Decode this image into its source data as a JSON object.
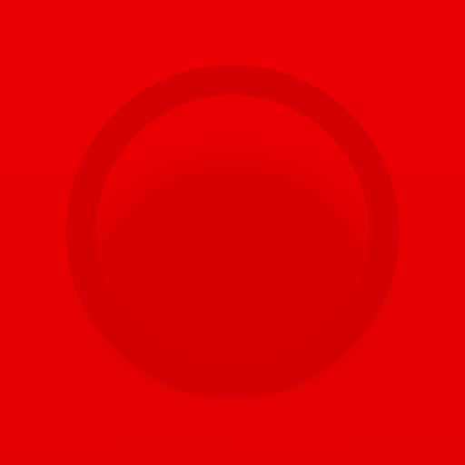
{
  "icon": {
    "name": "ring-logo-icon",
    "colors": {
      "background_top": "#ea0000",
      "background_bottom": "#e30000",
      "ring_top": "#ffffff",
      "ring_mid": "#f3c8c8",
      "ring_bottom": "#d20000",
      "shadow": "#b80000"
    }
  }
}
